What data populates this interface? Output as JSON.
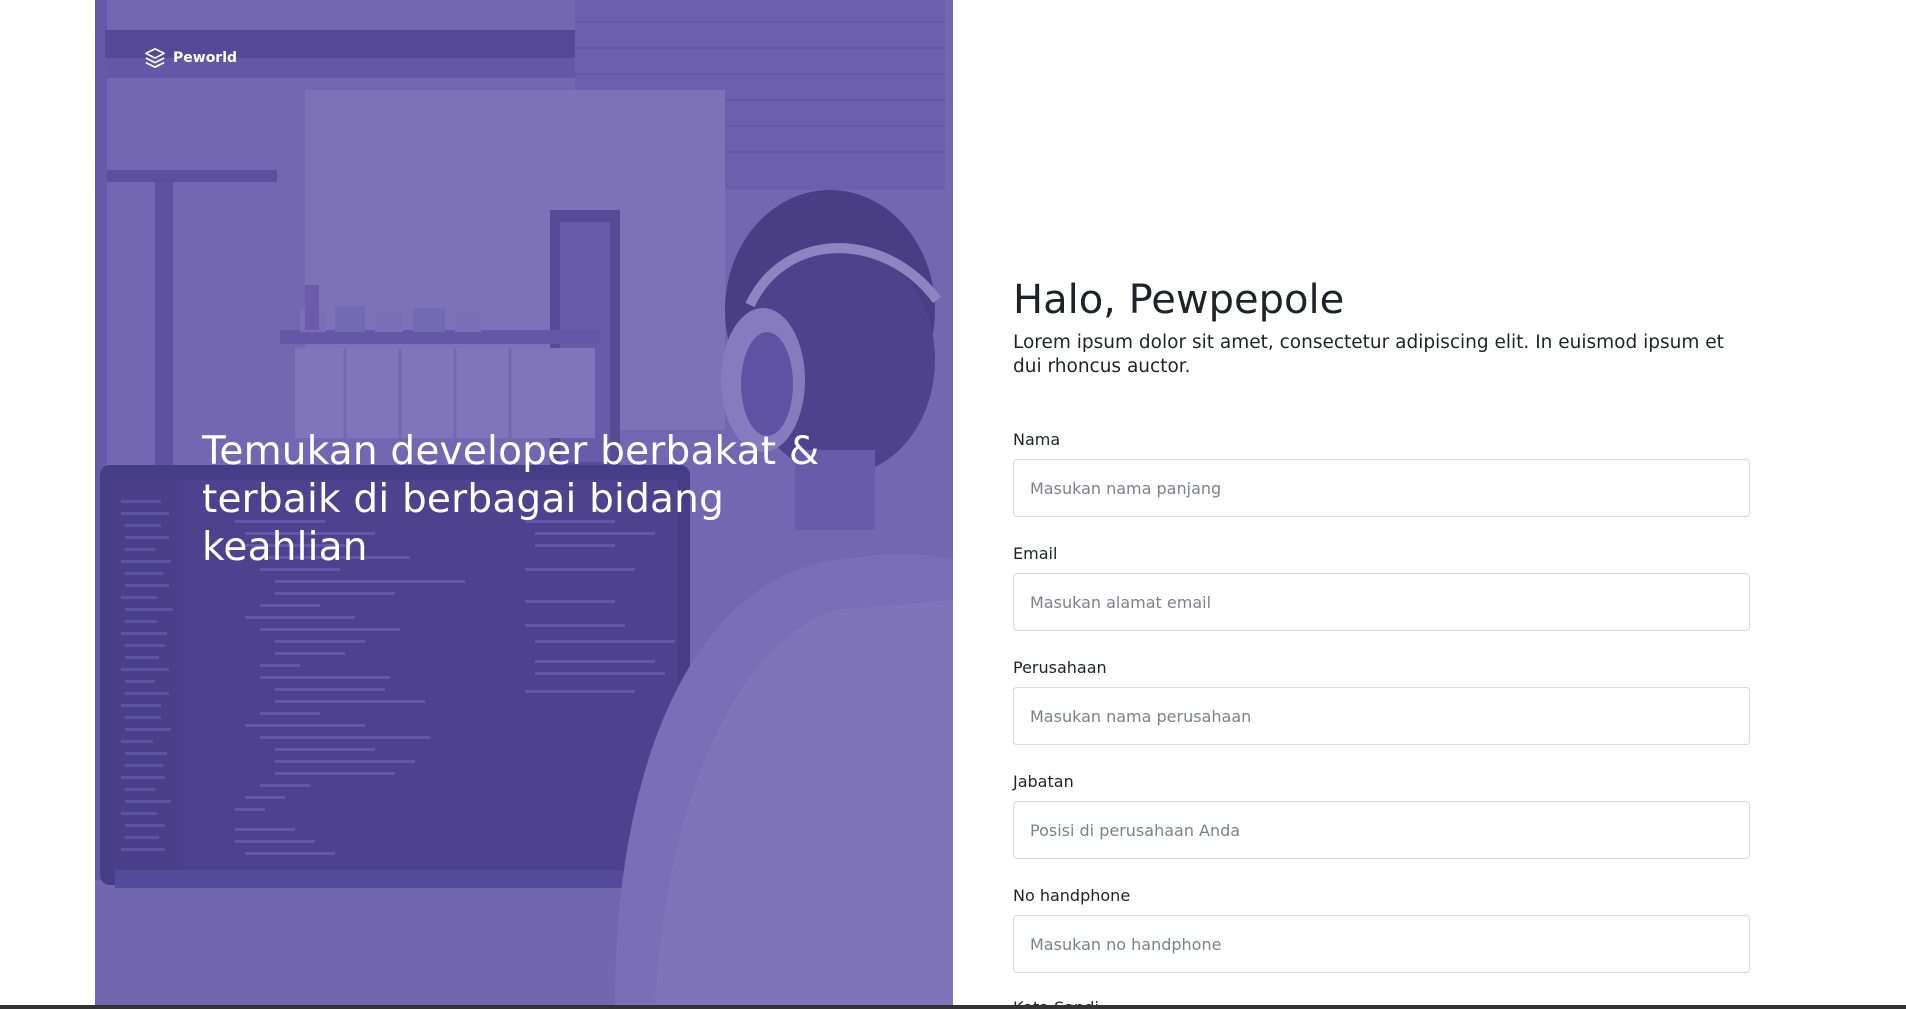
{
  "brand": {
    "name": "Peworld",
    "icon": "layers-icon"
  },
  "hero": {
    "headline": "Temukan developer berbakat & terbaik di berbagai bidang keahlian"
  },
  "form": {
    "greeting": "Halo, Pewpepole",
    "intro": "Lorem ipsum dolor sit amet, consectetur adipiscing elit. In euismod ipsum et dui rhoncus auctor.",
    "fields": [
      {
        "label": "Nama",
        "placeholder": "Masukan nama panjang"
      },
      {
        "label": "Email",
        "placeholder": "Masukan alamat email"
      },
      {
        "label": "Perusahaan",
        "placeholder": "Masukan nama perusahaan"
      },
      {
        "label": "Jabatan",
        "placeholder": "Posisi di perusahaan Anda"
      },
      {
        "label": "No handphone",
        "placeholder": "Masukan no handphone"
      },
      {
        "label": "Kata Sandi"
      }
    ]
  },
  "colors": {
    "hero_purple": "#5e50a1",
    "text_dark": "#1f2328",
    "input_border": "#d4d8dd",
    "placeholder": "#7a828a"
  }
}
